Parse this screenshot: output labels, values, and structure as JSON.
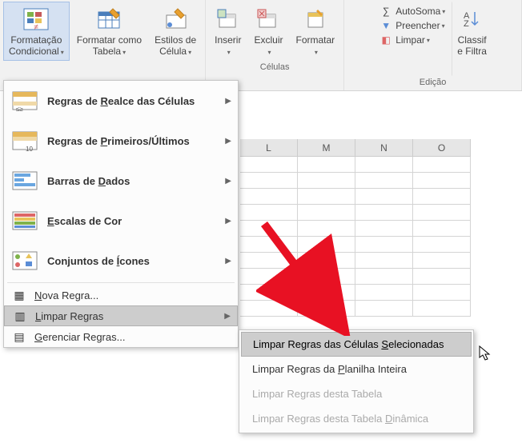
{
  "ribbon": {
    "styles": {
      "cond_fmt": "Formatação\nCondicional",
      "fmt_table": "Formatar como\nTabela",
      "cell_styles": "Estilos de\nCélula"
    },
    "cells_group": {
      "insert": "Inserir",
      "delete": "Excluir",
      "format": "Formatar",
      "label": "Células"
    },
    "editing_group": {
      "autosum": "AutoSoma",
      "fill": "Preencher",
      "clear": "Limpar",
      "label": "Edição",
      "sort": "Classif\ne Filtra"
    }
  },
  "columns": [
    "L",
    "M",
    "N",
    "O"
  ],
  "menu": {
    "highlight": "Regras de Realce das Células",
    "toprules": "Regras de Primeiros/Últimos",
    "databars": "Barras de Dados",
    "colorscales": "Escalas de Cor",
    "iconsets": "Conjuntos de Ícones",
    "newrule": "Nova Regra...",
    "clearrules": "Limpar Regras",
    "managerules": "Gerenciar Regras..."
  },
  "submenu": {
    "sel": "Limpar Regras das Células Selecionadas",
    "sheet": "Limpar Regras da Planilha Inteira",
    "table": "Limpar Regras desta Tabela",
    "pivot": "Limpar Regras desta Tabela Dinâmica"
  }
}
